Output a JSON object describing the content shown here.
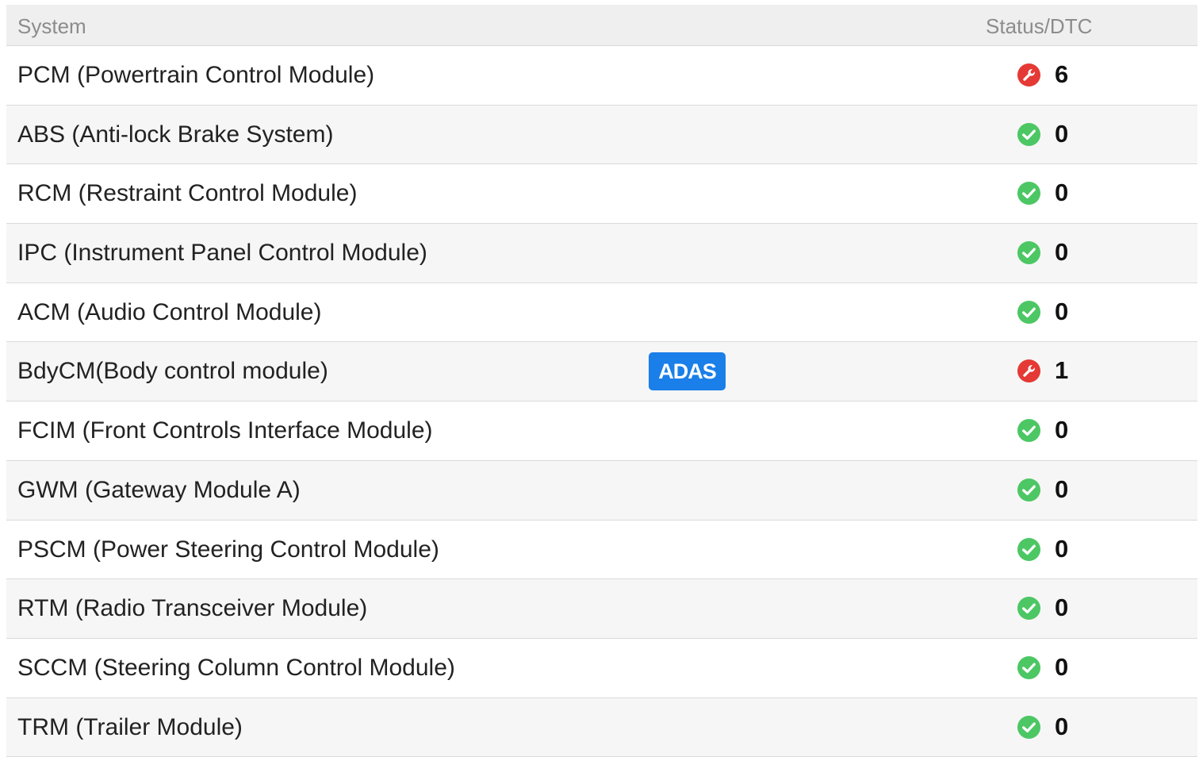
{
  "header": {
    "system_label": "System",
    "status_label": "Status/DTC"
  },
  "colors": {
    "ok": "#4cc764",
    "fault": "#e53935",
    "badge": "#1a7fe8"
  },
  "rows": [
    {
      "name": "PCM (Powertrain Control Module)",
      "status": "fault",
      "icon": "wrench-icon",
      "count": "6",
      "badge": ""
    },
    {
      "name": "ABS (Anti-lock Brake System)",
      "status": "ok",
      "icon": "check-icon",
      "count": "0",
      "badge": ""
    },
    {
      "name": "RCM (Restraint Control Module)",
      "status": "ok",
      "icon": "check-icon",
      "count": "0",
      "badge": ""
    },
    {
      "name": "IPC (Instrument Panel Control Module)",
      "status": "ok",
      "icon": "check-icon",
      "count": "0",
      "badge": ""
    },
    {
      "name": "ACM (Audio Control Module)",
      "status": "ok",
      "icon": "check-icon",
      "count": "0",
      "badge": ""
    },
    {
      "name": "BdyCM(Body control module)",
      "status": "fault",
      "icon": "wrench-icon",
      "count": "1",
      "badge": "ADAS"
    },
    {
      "name": "FCIM (Front Controls Interface Module)",
      "status": "ok",
      "icon": "check-icon",
      "count": "0",
      "badge": ""
    },
    {
      "name": "GWM (Gateway Module A)",
      "status": "ok",
      "icon": "check-icon",
      "count": "0",
      "badge": ""
    },
    {
      "name": "PSCM (Power Steering Control Module)",
      "status": "ok",
      "icon": "check-icon",
      "count": "0",
      "badge": ""
    },
    {
      "name": "RTM (Radio Transceiver Module)",
      "status": "ok",
      "icon": "check-icon",
      "count": "0",
      "badge": ""
    },
    {
      "name": "SCCM (Steering Column Control Module)",
      "status": "ok",
      "icon": "check-icon",
      "count": "0",
      "badge": ""
    },
    {
      "name": "TRM (Trailer Module)",
      "status": "ok",
      "icon": "check-icon",
      "count": "0",
      "badge": ""
    }
  ]
}
